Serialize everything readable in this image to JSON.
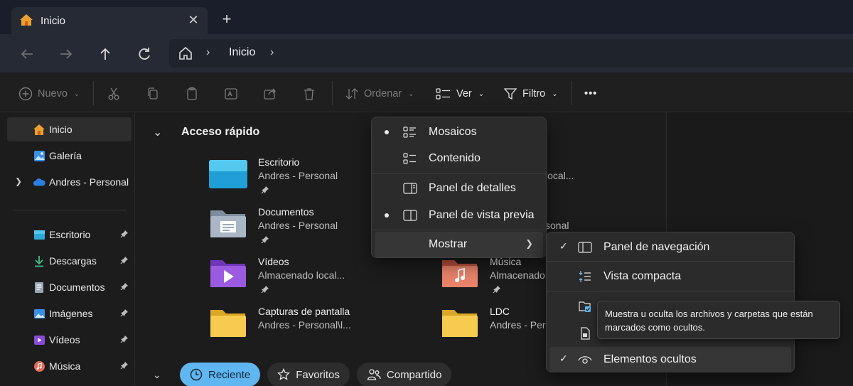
{
  "tab": {
    "title": "Inicio",
    "close": "✕",
    "new_tab": "+"
  },
  "address": {
    "separator": "›",
    "crumbs": [
      "Inicio"
    ]
  },
  "toolbar": {
    "new_label": "Nuevo",
    "sort_label": "Ordenar",
    "view_label": "Ver",
    "filter_label": "Filtro",
    "more_label": "•••"
  },
  "sidebar": {
    "items": [
      {
        "label": "Inicio",
        "icon": "home-icon"
      },
      {
        "label": "Galería",
        "icon": "gallery-icon"
      },
      {
        "label": "Andres - Personal",
        "icon": "onedrive-icon"
      },
      {
        "label": "Escritorio",
        "icon": "desktop-icon"
      },
      {
        "label": "Descargas",
        "icon": "download-icon"
      },
      {
        "label": "Documentos",
        "icon": "documents-icon"
      },
      {
        "label": "Imágenes",
        "icon": "pictures-icon"
      },
      {
        "label": "Vídeos",
        "icon": "videos-icon"
      },
      {
        "label": "Música",
        "icon": "music-icon"
      }
    ]
  },
  "main": {
    "section_title": "Acceso rápido",
    "quick_access": [
      {
        "name": "Escritorio",
        "location": "Andres - Personal",
        "icon": "desktop-folder-icon"
      },
      {
        "name": "Documentos",
        "location": "Andres - Personal",
        "icon": "documents-folder-icon"
      },
      {
        "name": "Vídeos",
        "location": "Almacenado local...",
        "icon": "videos-folder-icon"
      },
      {
        "name": "Capturas de pantalla",
        "location": "Andres - Personal\\l...",
        "icon": "folder-icon"
      },
      {
        "name": "",
        "location": "local...",
        "icon": ""
      },
      {
        "name": "",
        "location": "sonal",
        "icon": ""
      },
      {
        "name": "Música",
        "location": "Almacenado",
        "icon": "music-folder-icon"
      },
      {
        "name": "LDC",
        "location": "Andres - Per",
        "icon": "folder-icon"
      }
    ],
    "chips": [
      "Reciente",
      "Favoritos",
      "Compartido"
    ]
  },
  "view_menu": {
    "items": [
      "Mosaicos",
      "Contenido",
      "Panel de detalles",
      "Panel de vista previa",
      "Mostrar"
    ],
    "selected": [
      "Mosaicos",
      "Panel de vista previa"
    ]
  },
  "show_submenu": {
    "items": [
      "Panel de navegación",
      "Vista compacta",
      "Elementos ocultos"
    ],
    "checked": [
      "Panel de navegación",
      "Elementos ocultos"
    ]
  },
  "tooltip": {
    "line1": "Muestra u oculta los archivos y carpetas que están",
    "line2": "marcados como ocultos."
  },
  "colors": {
    "accent": "#5fb6f0",
    "folder": "#f4c64a",
    "background": "#1c1c1c"
  }
}
